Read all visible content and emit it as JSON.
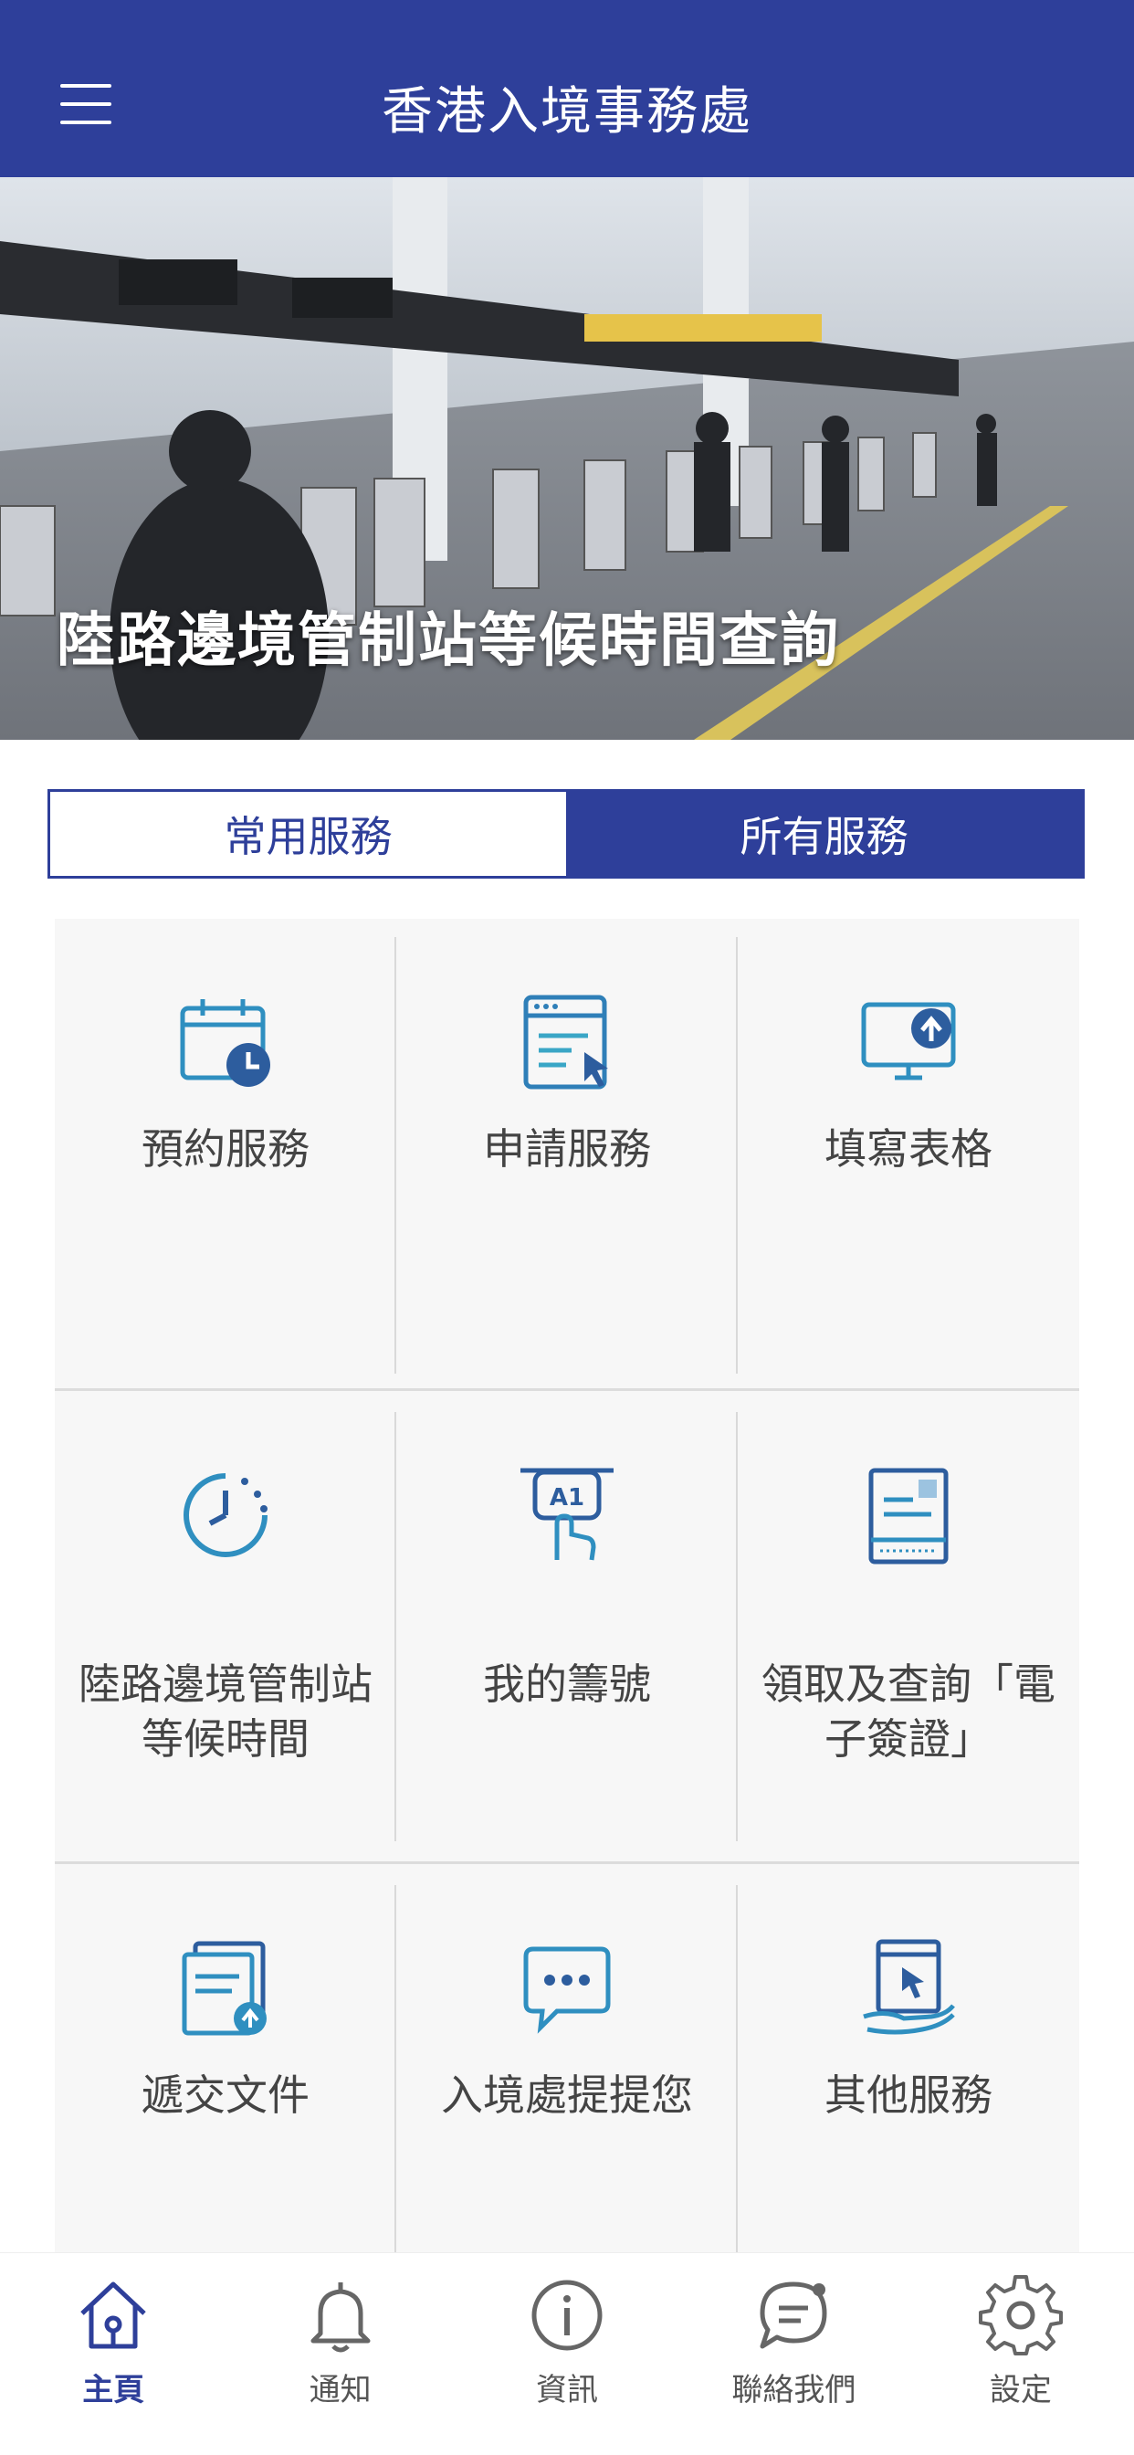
{
  "header": {
    "title": "香港入境事務處",
    "menu_icon": "hamburger-menu-icon"
  },
  "banner": {
    "caption": "陸路邊境管制站等候時間查詢",
    "slide_count": 8,
    "active_slide": 6
  },
  "tabs": [
    {
      "label": "常用服務",
      "selected": false
    },
    {
      "label": "所有服務",
      "selected": true
    }
  ],
  "services": [
    {
      "label": "預約服務",
      "icon": "calendar-clock-icon"
    },
    {
      "label": "申請服務",
      "icon": "application-form-icon"
    },
    {
      "label": "填寫表格",
      "icon": "monitor-upload-icon"
    },
    {
      "label": "陸路邊境管制站等候時間",
      "icon": "timer-icon"
    },
    {
      "label": "我的籌號",
      "icon": "ticket-number-icon"
    },
    {
      "label": "領取及查詢「電子簽證」",
      "icon": "e-visa-icon"
    },
    {
      "label": "遞交文件",
      "icon": "document-upload-icon"
    },
    {
      "label": "入境處提提您",
      "icon": "chat-bubble-icon"
    },
    {
      "label": "其他服務",
      "icon": "hand-tablet-icon"
    }
  ],
  "bottom_nav": [
    {
      "label": "主頁",
      "icon": "home-icon",
      "active": true
    },
    {
      "label": "通知",
      "icon": "bell-icon",
      "active": false
    },
    {
      "label": "資訊",
      "icon": "info-icon",
      "active": false
    },
    {
      "label": "聯絡我們",
      "icon": "chat-icon",
      "active": false
    },
    {
      "label": "設定",
      "icon": "gear-icon",
      "active": false
    }
  ],
  "colors": {
    "brand": "#2e3f9a",
    "icon_gradient_start": "#2d6fb8",
    "icon_gradient_end": "#3fb0c9"
  }
}
